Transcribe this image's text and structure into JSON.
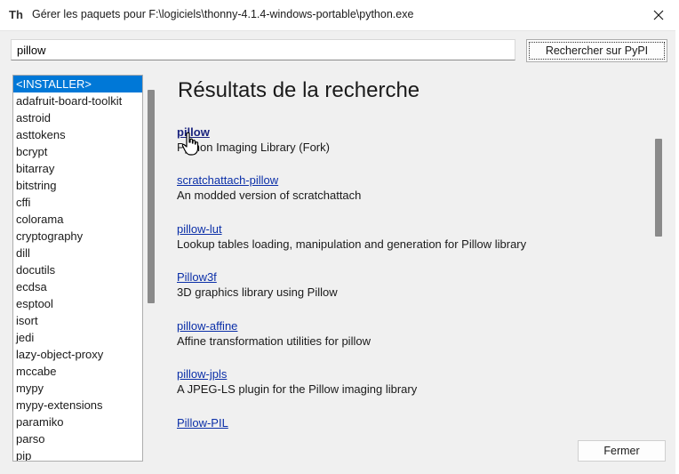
{
  "window": {
    "title": "Gérer les paquets pour F:\\logiciels\\thonny-4.1.4-windows-portable\\python.exe",
    "app_icon": "Th"
  },
  "search": {
    "value": "pillow",
    "button_label": "Rechercher sur PyPI"
  },
  "package_list": {
    "items": [
      "<INSTALLER>",
      "adafruit-board-toolkit",
      "astroid",
      "asttokens",
      "bcrypt",
      "bitarray",
      "bitstring",
      "cffi",
      "colorama",
      "cryptography",
      "dill",
      "docutils",
      "ecdsa",
      "esptool",
      "isort",
      "jedi",
      "lazy-object-proxy",
      "mccabe",
      "mypy",
      "mypy-extensions",
      "paramiko",
      "parso",
      "pip"
    ],
    "selected_index": 0
  },
  "results": {
    "heading": "Résultats de la recherche",
    "items": [
      {
        "name": "pillow",
        "description": "Python Imaging Library (Fork)"
      },
      {
        "name": "scratchattach-pillow",
        "description": "An modded version of scratchattach"
      },
      {
        "name": "pillow-lut",
        "description": "Lookup tables loading, manipulation and generation for Pillow library"
      },
      {
        "name": "Pillow3f",
        "description": "3D graphics library using Pillow"
      },
      {
        "name": "pillow-affine",
        "description": "Affine transformation utilities for pillow"
      },
      {
        "name": "pillow-jpls",
        "description": "A JPEG-LS plugin for the Pillow imaging library"
      },
      {
        "name": "Pillow-PIL",
        "description": ""
      }
    ]
  },
  "footer": {
    "close_label": "Fermer"
  },
  "colors": {
    "selection": "#0078d7",
    "link": "#0b2fa8"
  }
}
